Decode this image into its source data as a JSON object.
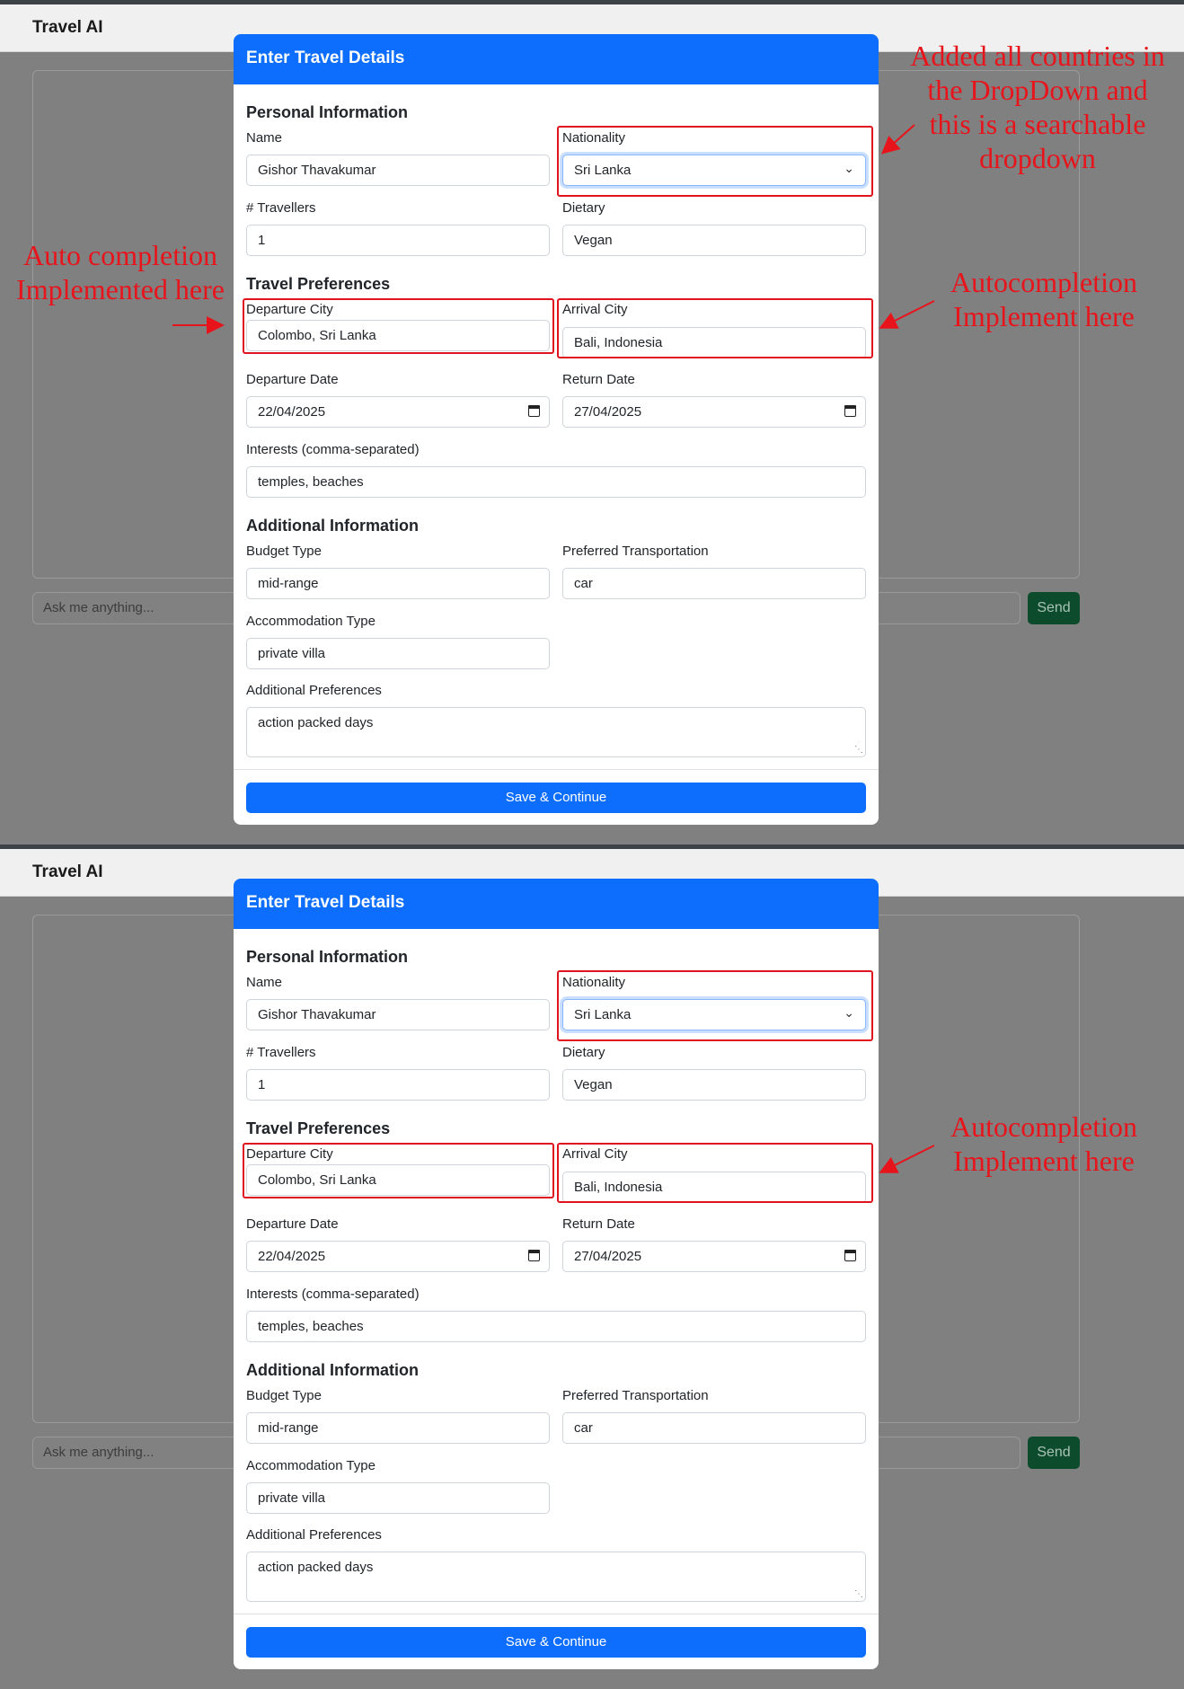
{
  "app": {
    "title": "Travel AI",
    "chat_placeholder": "Ask me anything...",
    "send_label": "Send"
  },
  "modal": {
    "title": "Enter Travel Details",
    "sections": {
      "personal": "Personal Information",
      "travel": "Travel Preferences",
      "additional": "Additional Information"
    },
    "fields": {
      "name": {
        "label": "Name",
        "value": "Gishor Thavakumar"
      },
      "nationality": {
        "label": "Nationality",
        "value": "Sri Lanka"
      },
      "travellers": {
        "label": "# Travellers",
        "value": "1"
      },
      "dietary": {
        "label": "Dietary",
        "value": "Vegan"
      },
      "departure_city": {
        "label": "Departure City",
        "value": "Colombo, Sri Lanka"
      },
      "arrival_city": {
        "label": "Arrival City",
        "value": "Bali, Indonesia"
      },
      "departure_date": {
        "label": "Departure Date",
        "value": "22/04/2025"
      },
      "return_date": {
        "label": "Return Date",
        "value": "27/04/2025"
      },
      "interests": {
        "label": "Interests (comma-separated)",
        "value": "temples, beaches"
      },
      "budget": {
        "label": "Budget Type",
        "value": "mid-range"
      },
      "transport": {
        "label": "Preferred Transportation",
        "value": "car"
      },
      "accommodation": {
        "label": "Accommodation Type",
        "value": "private villa"
      },
      "additional_prefs": {
        "label": "Additional Preferences",
        "value": "action packed days"
      }
    },
    "save_label": "Save & Continue"
  },
  "annotations": {
    "dropdown": "Added all countries in the DropDown and this is a searchable dropdown",
    "departure": "Auto completion Implemented here",
    "arrival": "Autocompletion Implement here"
  },
  "colors": {
    "primary": "#0d6efd",
    "annotation": "#e8141c",
    "send_button": "#0c4b2c",
    "overlay": "#808080"
  }
}
